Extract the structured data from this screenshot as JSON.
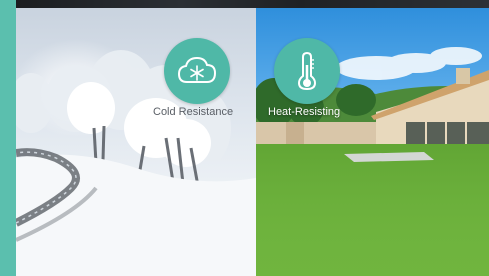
{
  "features": {
    "cold": {
      "label": "Cold Resistance",
      "icon": "cloud-snowflake-icon",
      "accent": "#4fb8a7"
    },
    "heat": {
      "label": "Heat-Resisting",
      "icon": "thermometer-icon",
      "accent": "#4fb8a7"
    }
  },
  "colors": {
    "frame": "#5bbfae",
    "icon_fill": "#ffffff"
  }
}
